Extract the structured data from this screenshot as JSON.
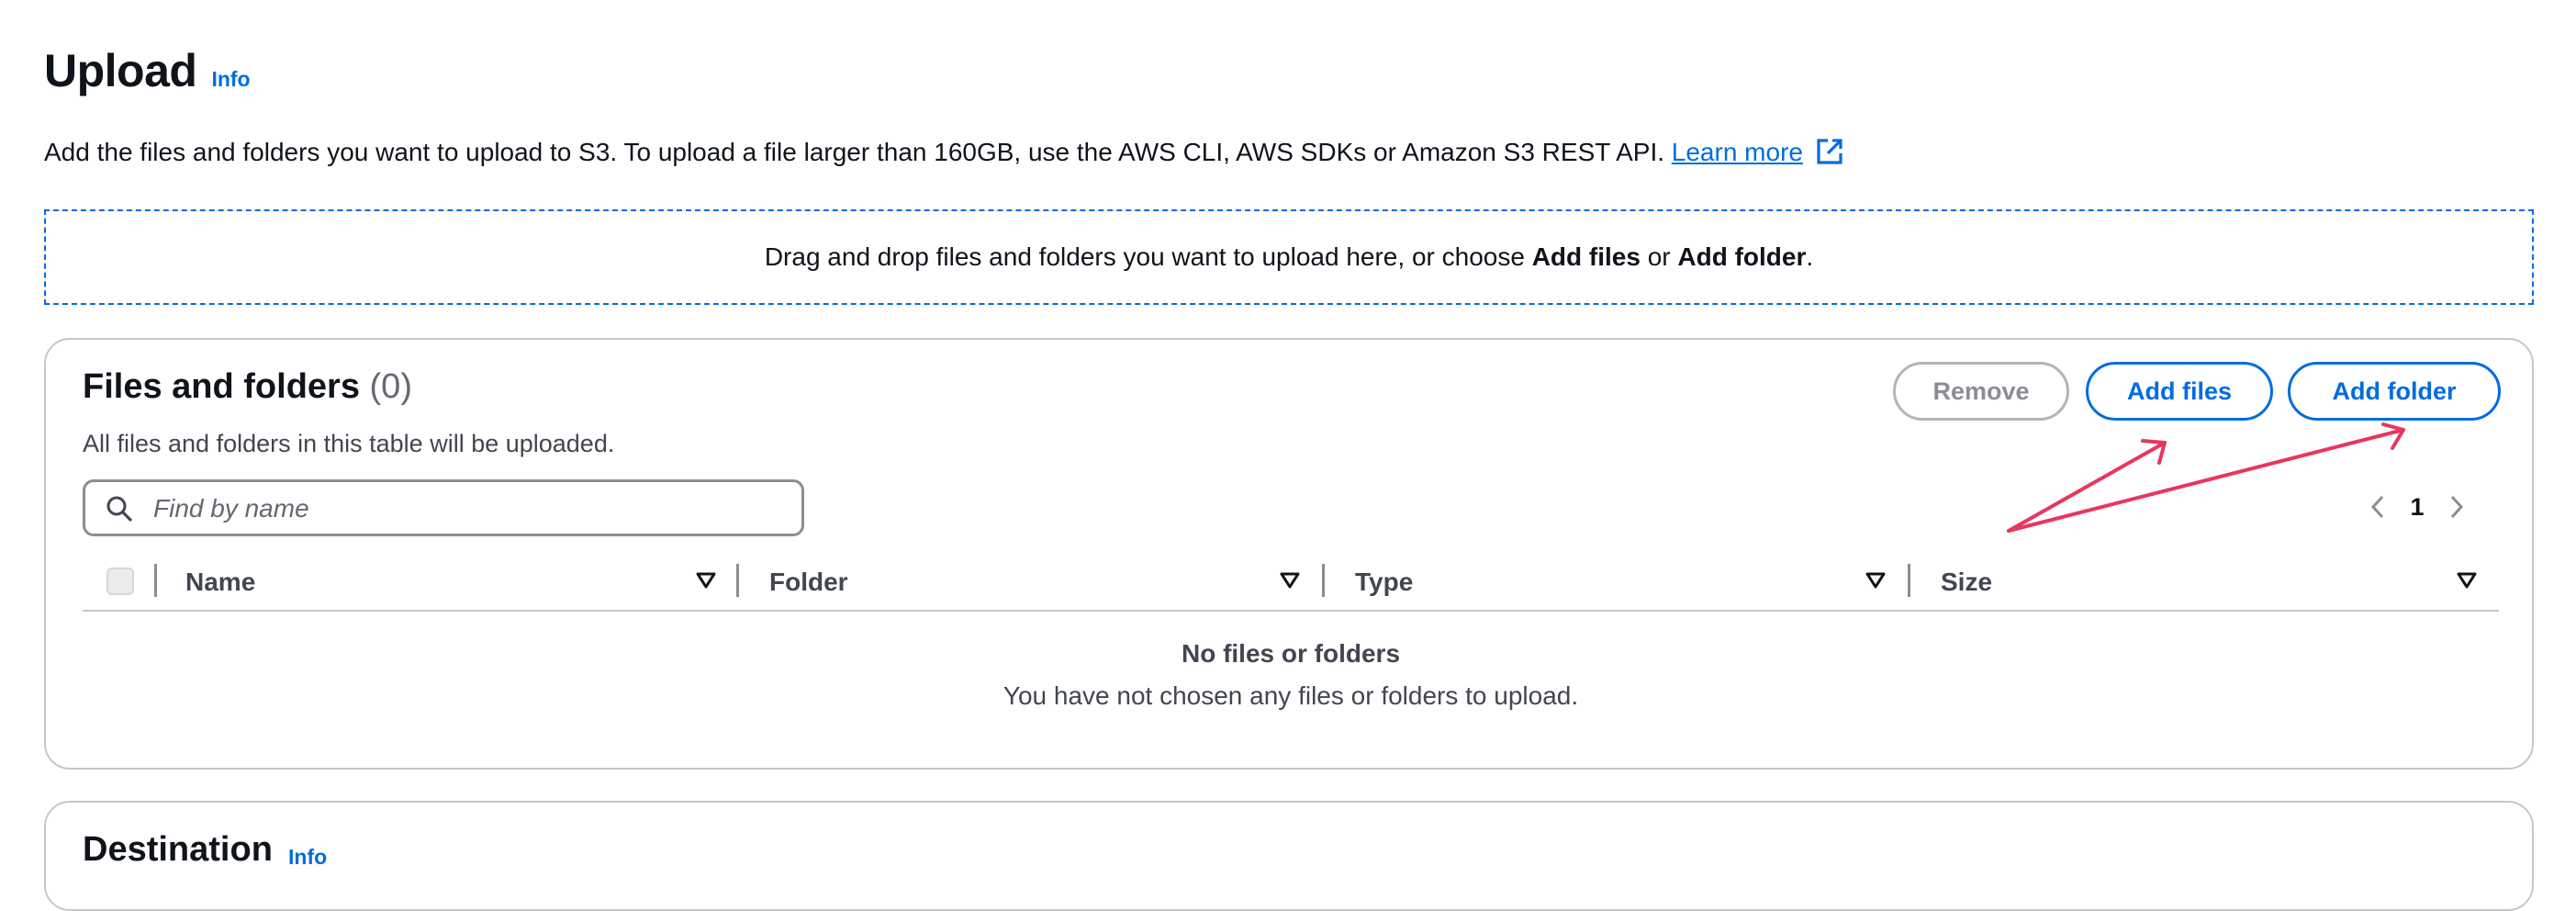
{
  "header": {
    "title": "Upload",
    "info_label": "Info"
  },
  "description": {
    "text": "Add the files and folders you want to upload to S3. To upload a file larger than 160GB, use the AWS CLI, AWS SDKs or Amazon S3 REST API.",
    "learn_more": "Learn more"
  },
  "dropzone": {
    "prefix": "Drag and drop files and folders you want to upload here, or choose ",
    "add_files": "Add files",
    "or": " or ",
    "add_folder": "Add folder",
    "suffix": "."
  },
  "files_panel": {
    "title": "Files and folders",
    "count": "(0)",
    "subtitle": "All files and folders in this table will be uploaded.",
    "buttons": {
      "remove": "Remove",
      "add_files": "Add files",
      "add_folder": "Add folder"
    },
    "search": {
      "placeholder": "Find by name",
      "value": ""
    },
    "pagination": {
      "current_page": "1"
    },
    "columns": [
      "Name",
      "Folder",
      "Type",
      "Size"
    ],
    "empty": {
      "title": "No files or folders",
      "message": "You have not chosen any files or folders to upload."
    }
  },
  "destination": {
    "title": "Destination",
    "info_label": "Info"
  },
  "icons": {
    "external_link": "external-link-icon",
    "search": "search-icon",
    "prev": "chevron-left-icon",
    "next": "chevron-right-icon",
    "sort": "sort-caret-icon"
  },
  "colors": {
    "link": "#006ce0",
    "border": "#c6c6cd",
    "annotation": "#e8365d"
  }
}
